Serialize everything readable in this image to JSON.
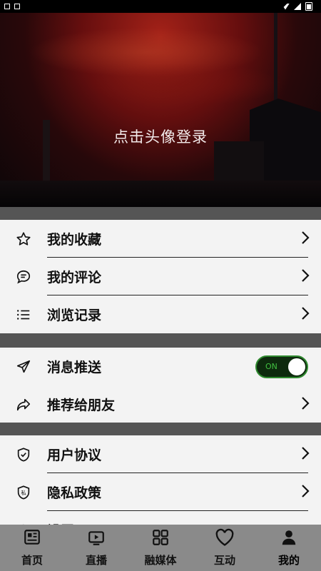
{
  "status_bar": {
    "time": ""
  },
  "hero": {
    "login_prompt": "点击头像登录"
  },
  "group1": [
    {
      "label": "我的收藏",
      "icon": "star-icon"
    },
    {
      "label": "我的评论",
      "icon": "comment-icon"
    },
    {
      "label": "浏览记录",
      "icon": "list-icon"
    }
  ],
  "group2": [
    {
      "label": "消息推送",
      "icon": "send-icon",
      "toggle": "ON"
    },
    {
      "label": "推荐给朋友",
      "icon": "share-icon"
    }
  ],
  "group3": [
    {
      "label": "用户协议",
      "icon": "shield-icon"
    },
    {
      "label": "隐私政策",
      "icon": "private-shield-icon"
    },
    {
      "label": "设置",
      "icon": "settings-icon"
    }
  ],
  "bottom_nav": [
    {
      "label": "首页",
      "icon": "home-news-icon"
    },
    {
      "label": "直播",
      "icon": "live-tv-icon"
    },
    {
      "label": "融媒体",
      "icon": "grid-icon"
    },
    {
      "label": "互动",
      "icon": "heart-icon"
    },
    {
      "label": "我的",
      "icon": "person-icon",
      "active": true
    }
  ],
  "colors": {
    "toggle_on": "#41c041",
    "bottom_nav_bg": "#8a8a8a",
    "band": "#555555"
  }
}
